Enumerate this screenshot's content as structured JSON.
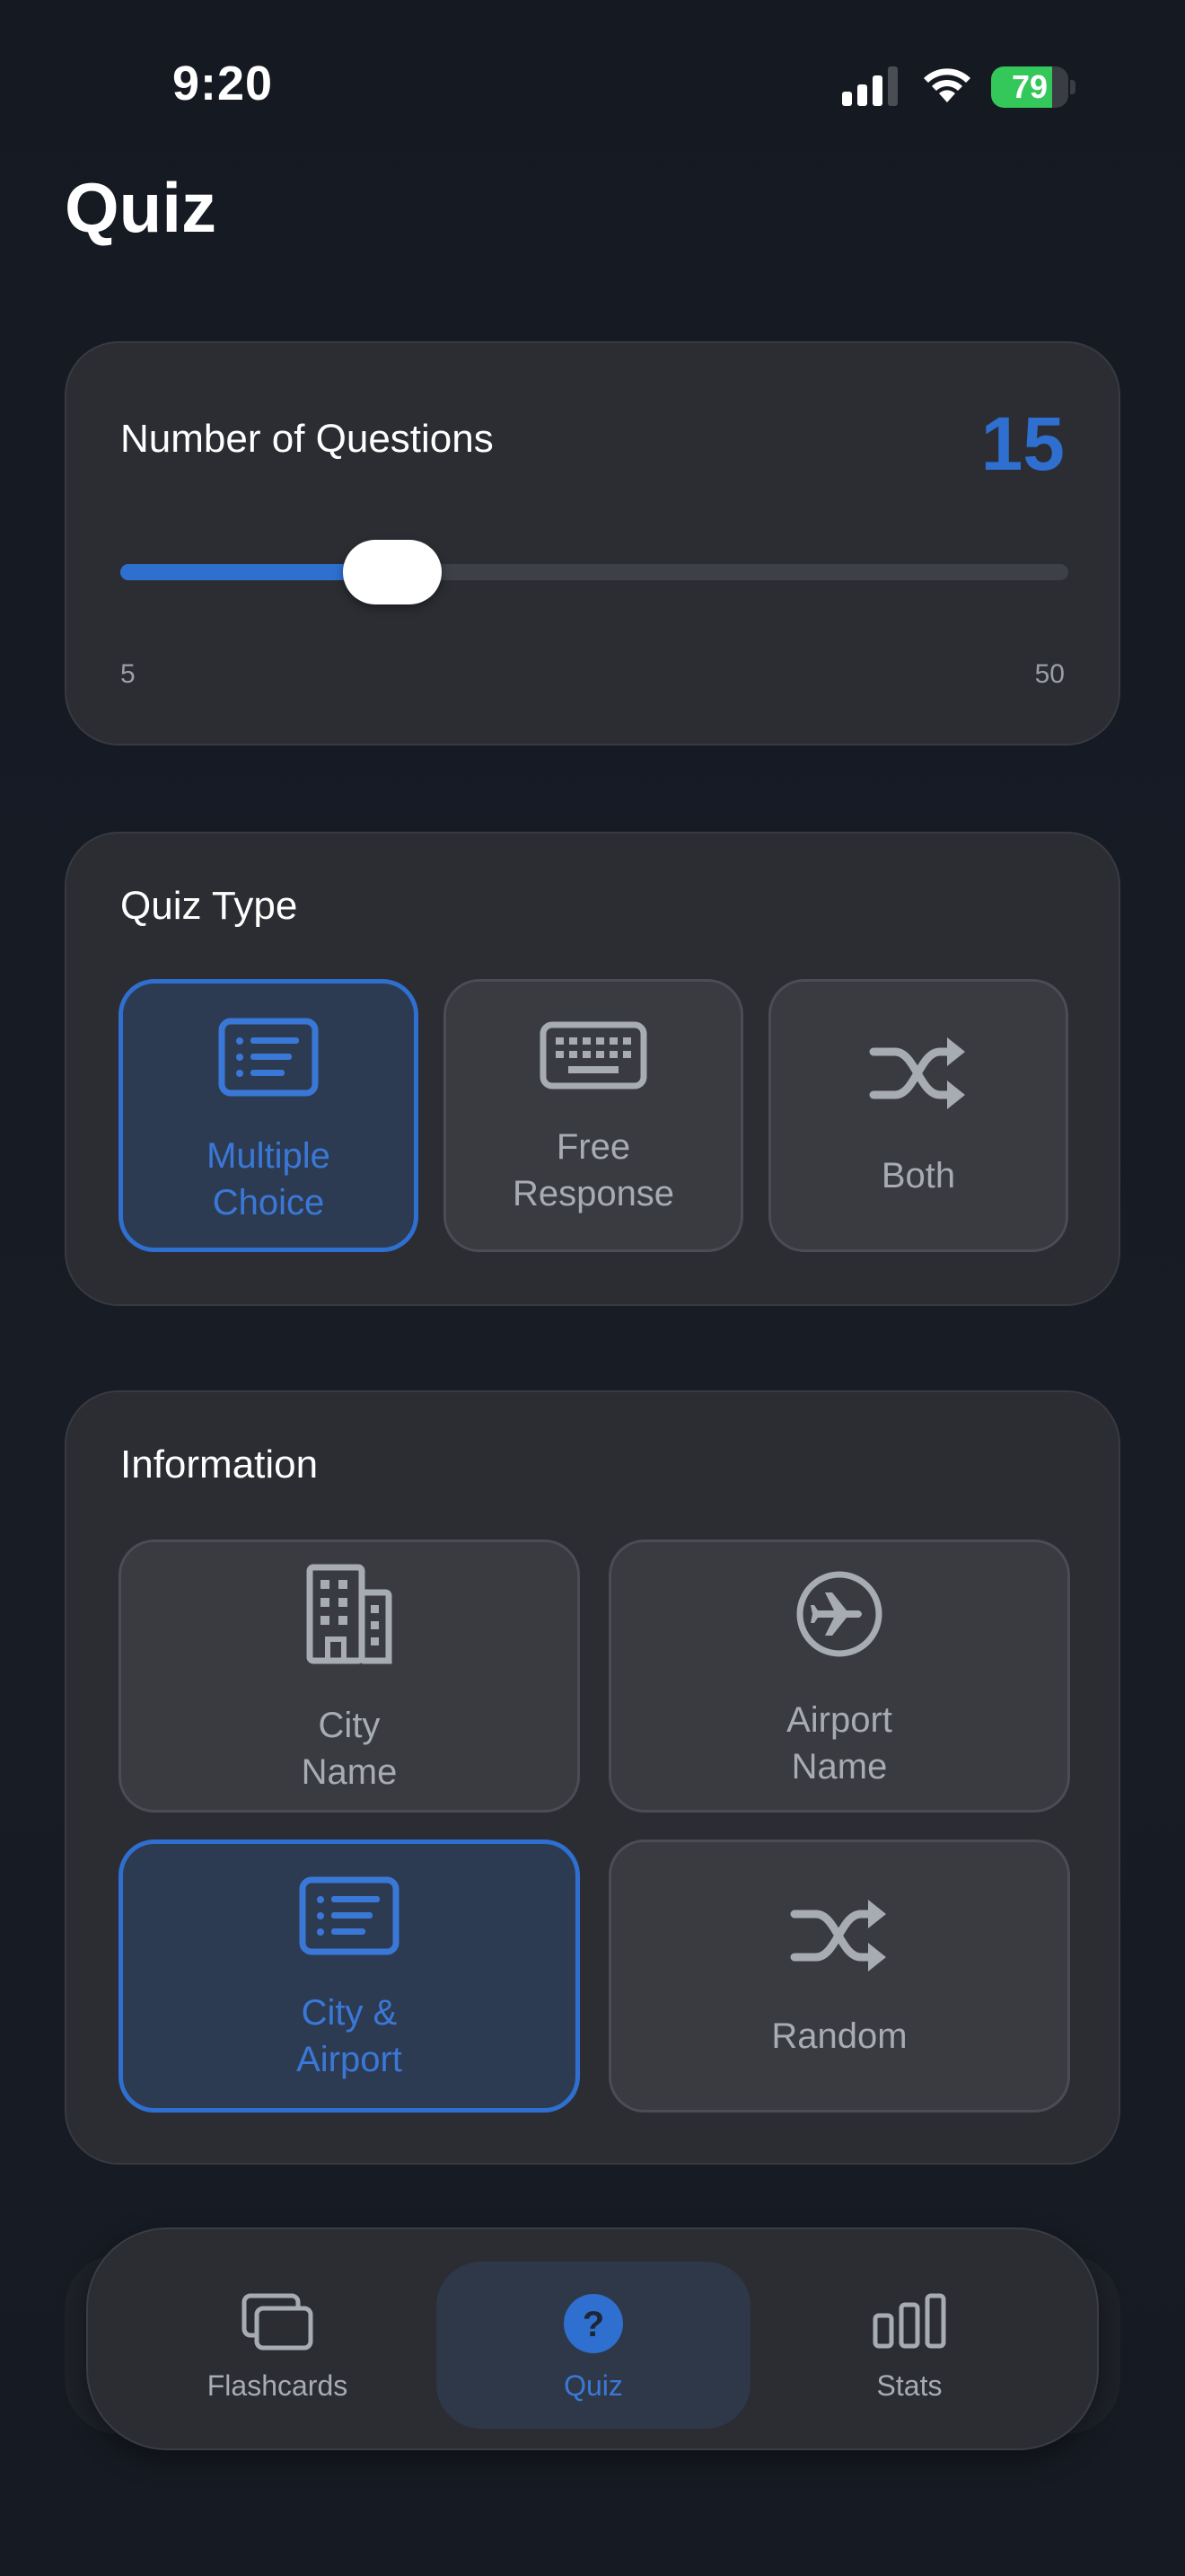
{
  "status_bar": {
    "time": "9:20",
    "battery_percent": 79,
    "battery_text": "79",
    "icons": [
      "cellular-signal-icon",
      "wifi-icon",
      "battery-charging-icon"
    ]
  },
  "page": {
    "title": "Quiz"
  },
  "questions": {
    "label": "Number of Questions",
    "value": "15",
    "min": "5",
    "max": "50",
    "slider_value": 15,
    "slider_min": 5,
    "slider_max": 50
  },
  "quiz_type": {
    "title": "Quiz Type",
    "options": [
      {
        "label": "Multiple\nChoice",
        "icon": "list-card-icon",
        "selected": true
      },
      {
        "label": "Free\nResponse",
        "icon": "keyboard-icon",
        "selected": false
      },
      {
        "label": "Both",
        "icon": "shuffle-icon",
        "selected": false
      }
    ]
  },
  "information": {
    "title": "Information",
    "options": [
      {
        "label": "City\nName",
        "icon": "building-icon",
        "selected": false
      },
      {
        "label": "Airport\nName",
        "icon": "airplane-circle-icon",
        "selected": false
      },
      {
        "label": "City &\nAirport",
        "icon": "list-card-icon",
        "selected": true
      },
      {
        "label": "Random",
        "icon": "shuffle-icon",
        "selected": false
      }
    ]
  },
  "tabbar": {
    "tabs": [
      {
        "label": "Flashcards",
        "icon": "cards-stack-icon",
        "active": false
      },
      {
        "label": "Quiz",
        "icon": "question-circle-icon",
        "active": true
      },
      {
        "label": "Stats",
        "icon": "bar-chart-icon",
        "active": false
      }
    ]
  },
  "colors": {
    "accent": "#2f6fd0",
    "card_background": "#2b2d33",
    "page_background": "#161a23",
    "battery_green": "#34c759"
  }
}
